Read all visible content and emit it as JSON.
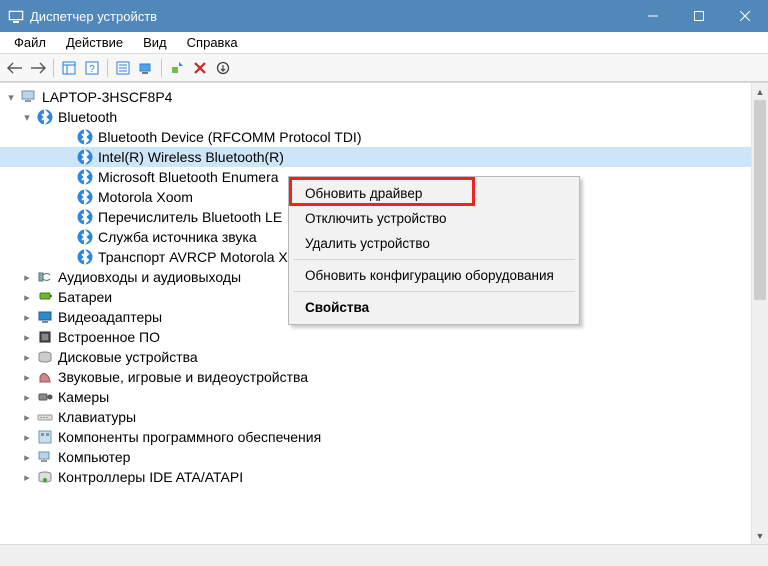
{
  "window_title": "Диспетчер устройств",
  "menu": {
    "file": "Файл",
    "action": "Действие",
    "view": "Вид",
    "help": "Справка"
  },
  "tree": {
    "root": "LAPTOP-3HSCF8P4",
    "bluetooth": {
      "label": "Bluetooth",
      "items": [
        "Bluetooth Device (RFCOMM Protocol TDI)",
        "Intel(R) Wireless Bluetooth(R)",
        "Microsoft Bluetooth Enumera",
        "Motorola Xoom",
        "Перечислитель Bluetooth LE",
        "Служба источника звука",
        "Транспорт AVRCP Motorola X"
      ]
    },
    "categories": [
      "Аудиовходы и аудиовыходы",
      "Батареи",
      "Видеоадаптеры",
      "Встроенное ПО",
      "Дисковые устройства",
      "Звуковые, игровые и видеоустройства",
      "Камеры",
      "Клавиатуры",
      "Компоненты программного обеспечения",
      "Компьютер",
      "Контроллеры IDE ATA/ATAPI"
    ]
  },
  "context_menu": {
    "update_driver": "Обновить драйвер",
    "disable_device": "Отключить устройство",
    "uninstall_device": "Удалить устройство",
    "scan_hardware": "Обновить конфигурацию оборудования",
    "properties": "Свойства"
  }
}
